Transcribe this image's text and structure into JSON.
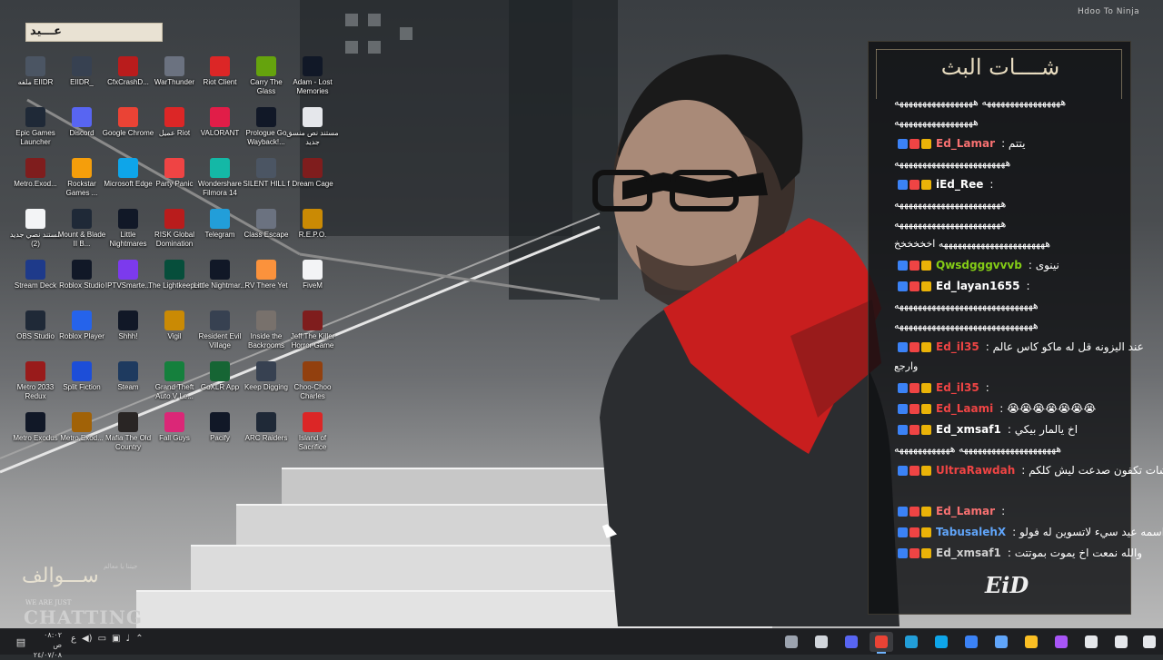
{
  "watermark": "Hdoo To Ninja",
  "banner": {
    "text": "عـــيد"
  },
  "desktop_icons": [
    {
      "label": "ملفه EIIDR",
      "color": "#4b5563"
    },
    {
      "label": "EIIDR_",
      "color": "#374151"
    },
    {
      "label": "CfxCrashD...",
      "color": "#b91c1c"
    },
    {
      "label": "WarThunder",
      "color": "#6b7280"
    },
    {
      "label": "Riot Client",
      "color": "#dc2626"
    },
    {
      "label": "Carry The Glass",
      "color": "#65a30d"
    },
    {
      "label": "Adam - Lost Memories",
      "color": "#111827"
    },
    {
      "label": "Epic Games Launcher",
      "color": "#1f2937"
    },
    {
      "label": "Discord",
      "color": "#5865f2"
    },
    {
      "label": "Google Chrome",
      "color": "#ea4335"
    },
    {
      "label": "عميل Riot",
      "color": "#dc2626"
    },
    {
      "label": "VALORANT",
      "color": "#e11d48"
    },
    {
      "label": "Prologue Go Wayback!...",
      "color": "#111827"
    },
    {
      "label": "مستند نص منسق جديد",
      "color": "#e5e7eb"
    },
    {
      "label": "Metro.Exod...",
      "color": "#7f1d1d"
    },
    {
      "label": "Rockstar Games ...",
      "color": "#f59e0b"
    },
    {
      "label": "Microsoft Edge",
      "color": "#0ea5e9"
    },
    {
      "label": "Party Panic",
      "color": "#ef4444"
    },
    {
      "label": "Wondershare Filmora 14",
      "color": "#14b8a6"
    },
    {
      "label": "SILENT HILL f",
      "color": "#4b5563"
    },
    {
      "label": "Dream Cage",
      "color": "#7f1d1d"
    },
    {
      "label": "مستند نصي جديد (2)",
      "color": "#f3f4f6"
    },
    {
      "label": "Mount & Blade II B...",
      "color": "#1f2937"
    },
    {
      "label": "Little Nightmares",
      "color": "#111827"
    },
    {
      "label": "RISK Global Domination",
      "color": "#b91c1c"
    },
    {
      "label": "Telegram",
      "color": "#229ed9"
    },
    {
      "label": "Class Escape",
      "color": "#6b7280"
    },
    {
      "label": "R.E.P.O.",
      "color": "#ca8a04"
    },
    {
      "label": "Stream Deck",
      "color": "#1e3a8a"
    },
    {
      "label": "Roblox Studio",
      "color": "#111827"
    },
    {
      "label": "IPTVSmarte...",
      "color": "#7c3aed"
    },
    {
      "label": "The Lightkeeper",
      "color": "#064e3b"
    },
    {
      "label": "Little Nightmar...",
      "color": "#111827"
    },
    {
      "label": "RV There Yet",
      "color": "#fb923c"
    },
    {
      "label": "FiveM",
      "color": "#f3f4f6"
    },
    {
      "label": "OBS Studio",
      "color": "#1f2937"
    },
    {
      "label": "Roblox Player",
      "color": "#2563eb"
    },
    {
      "label": "Shhh!",
      "color": "#111827"
    },
    {
      "label": "Vigil",
      "color": "#ca8a04"
    },
    {
      "label": "Resident Evil Village",
      "color": "#374151"
    },
    {
      "label": "Inside the Backrooms",
      "color": "#78716c"
    },
    {
      "label": "Jeff The Killer Horror Game",
      "color": "#7f1d1d"
    },
    {
      "label": "Metro 2033 Redux",
      "color": "#991b1b"
    },
    {
      "label": "Split Fiction",
      "color": "#1d4ed8"
    },
    {
      "label": "Steam",
      "color": "#1e3a5f"
    },
    {
      "label": "Grand Theft Auto V Le...",
      "color": "#15803d"
    },
    {
      "label": "GoXLR App",
      "color": "#166534"
    },
    {
      "label": "Keep Digging",
      "color": "#374151"
    },
    {
      "label": "Choo-Choo Charles",
      "color": "#92400e"
    },
    {
      "label": "Metro Exodus",
      "color": "#111827"
    },
    {
      "label": "Metro.Exod...",
      "color": "#a16207"
    },
    {
      "label": "Mafia The Old Country",
      "color": "#292524"
    },
    {
      "label": "Fall Guys",
      "color": "#db2777"
    },
    {
      "label": "Pacify",
      "color": "#111827"
    },
    {
      "label": "ARC Raiders",
      "color": "#1f2937"
    },
    {
      "label": "Island of Sacrifice",
      "color": "#dc2626"
    }
  ],
  "chat": {
    "title": "شــــات البث",
    "lines": [
      {
        "kind": "text",
        "text": "هههههههههههههههههه هههههههههههههههههه"
      },
      {
        "kind": "text",
        "text": "هههههههههههههههههه"
      },
      {
        "kind": "msg",
        "user": "Ed_Lamar",
        "user_color": "#f87171",
        "text": ": يتتم"
      },
      {
        "kind": "text",
        "text": "ههههههههههههههههههههههههه"
      },
      {
        "kind": "msg",
        "user": "iEd_Ree",
        "user_color": "#ffffff",
        "text": ":"
      },
      {
        "kind": "text",
        "text": "هههههههههههههههههههههههه"
      },
      {
        "kind": "text",
        "text": "هههههههههههههههههههههههه"
      },
      {
        "kind": "text",
        "text": "هههههههههههههههههههههههه اخخخخخخ"
      },
      {
        "kind": "msg",
        "user": "Qwsdgggvvvb",
        "user_color": "#84cc16",
        "text": ": نينوى"
      },
      {
        "kind": "msg",
        "user": "Ed_layan1655",
        "user_color": "#ffffff",
        "text": ":"
      },
      {
        "kind": "text",
        "text": "ههههههههههههههههههههههههههههههه"
      },
      {
        "kind": "text",
        "text": "ههههههههههههههههههههههههههههههه"
      },
      {
        "kind": "msg",
        "user": "Ed_il35",
        "user_color": "#ef4444",
        "text": ": عند اليزونه قل له ماكو كاس عالم"
      },
      {
        "kind": "text",
        "text": "وارجع"
      },
      {
        "kind": "msg",
        "user": "Ed_il35",
        "user_color": "#ef4444",
        "text": ":"
      },
      {
        "kind": "msg",
        "user": "Ed_Laami",
        "user_color": "#ef4444",
        "text": ": 😭😭😭😭😭😭😭"
      },
      {
        "kind": "msg",
        "user": "Ed_xmsaf1",
        "user_color": "#ffffff",
        "text": ": اخ يالمار بيكي"
      },
      {
        "kind": "text",
        "text": "هههههههههههههههههههههه ههههههههههههه"
      },
      {
        "kind": "msg",
        "user": "UltraRawdah",
        "user_color": "#ef4444",
        "text": ": شات تكفون صدعت ليش كلكم Ed؟"
      },
      {
        "kind": "text",
        "text": ""
      },
      {
        "kind": "msg",
        "user": "Ed_Lamar",
        "user_color": "#f87171",
        "text": ":"
      },
      {
        "kind": "msg",
        "user": "TabusalehX",
        "user_color": "#60a5fa",
        "text": ": واحد اسمه عيد سيء لاتسوين له فولو"
      },
      {
        "kind": "msg",
        "user": "Ed_xmsaf1",
        "user_color": "#cfcfcf",
        "text": ": والله نمعت اخ يموت بموتتت"
      }
    ]
  },
  "bottom_logo": {
    "arabic": "ســـوالف",
    "tag": "جيتنا يا معالم",
    "small": "WE ARE JUST",
    "big": "CHATTING"
  },
  "chat_logo": "EiD",
  "clock": {
    "time": "٠٨:٠٢ ص",
    "date": "٢٤/٠٧/٠٨"
  },
  "tray_lang": "ع",
  "taskbar_icons": [
    {
      "name": "task-view-icon",
      "color": "#9ca3af"
    },
    {
      "name": "obs-icon",
      "color": "#d1d5db"
    },
    {
      "name": "discord-icon",
      "color": "#5865f2"
    },
    {
      "name": "chrome-icon",
      "color": "#ea4335",
      "active": true
    },
    {
      "name": "telegram-icon",
      "color": "#229ed9"
    },
    {
      "name": "edge-icon",
      "color": "#0ea5e9"
    },
    {
      "name": "mail-icon",
      "color": "#3b82f6"
    },
    {
      "name": "store-icon",
      "color": "#60a5fa"
    },
    {
      "name": "file-explorer-icon",
      "color": "#fbbf24"
    },
    {
      "name": "copilot-icon",
      "color": "#a855f7"
    },
    {
      "name": "widgets-icon",
      "color": "#e5e7eb"
    },
    {
      "name": "search-icon",
      "color": "#e5e7eb"
    },
    {
      "name": "start-icon",
      "color": "#e5e7eb"
    }
  ]
}
